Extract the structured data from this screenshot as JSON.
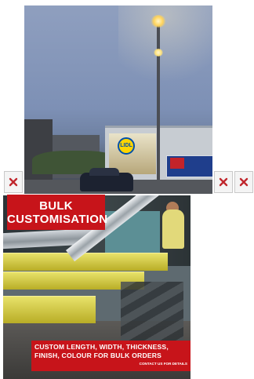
{
  "ads": {
    "top": {
      "store_logo_text": "LIDL"
    },
    "bottom": {
      "headline": [
        "BULK",
        "CUSTOMISATION"
      ],
      "caption_lines": [
        "CUSTOM LENGTH, WIDTH, THICKNESS,",
        "FINISH, COLOUR FOR BULK ORDERS"
      ],
      "cta": "CONTACT US FOR DETAILS"
    }
  },
  "close_buttons": [
    {
      "icon": "close-icon",
      "color": "#c0272d"
    },
    {
      "icon": "close-icon",
      "color": "#c0272d"
    },
    {
      "icon": "close-icon",
      "color": "#c0272d"
    }
  ],
  "colors": {
    "brand_red": "#c7141a",
    "close_x": "#c0272d"
  }
}
